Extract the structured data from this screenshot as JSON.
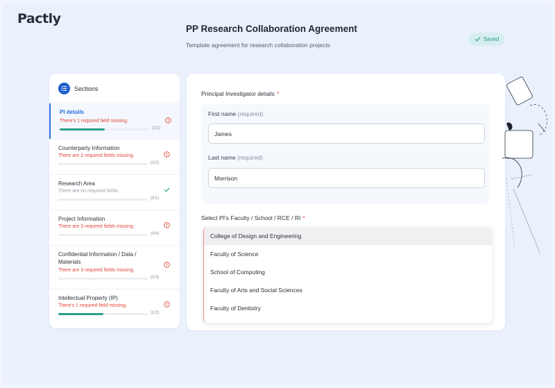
{
  "brand": {
    "logo": "Pactly"
  },
  "header": {
    "title": "PP Research Collaboration Agreement",
    "subtitle": "Template agreement for research collaboration projects",
    "saved_label": "Saved"
  },
  "sidebar": {
    "title": "Sections",
    "items": [
      {
        "label": "PI details",
        "status_text": "There's 1 required field missing.",
        "count": "(1/2)",
        "progress": 0.5,
        "state": "error",
        "active": true
      },
      {
        "label": "Counterparty Information",
        "status_text": "There are 2 required fields missing.",
        "count": "(0/2)",
        "progress": 0,
        "state": "error",
        "active": false
      },
      {
        "label": "Research Area",
        "status_text": "There are no required fields.",
        "count": "(0/1)",
        "progress": 0,
        "state": "ok",
        "active": false
      },
      {
        "label": "Project Information",
        "status_text": "There are 3 required fields missing.",
        "count": "(0/4)",
        "progress": 0,
        "state": "error",
        "active": false
      },
      {
        "label": "Confidential Information / Data / Materials",
        "status_text": "There are 3 required fields missing.",
        "count": "(0/3)",
        "progress": 0,
        "state": "error",
        "active": false
      },
      {
        "label": "Intellectual Property (IP)",
        "status_text": "There's 1 required field missing.",
        "count": "(1/2)",
        "progress": 0.5,
        "state": "error",
        "active": false
      }
    ]
  },
  "form": {
    "pi_section_title": "Principal Investigator details",
    "required_star": "*",
    "first_name": {
      "label": "First name",
      "hint": "(required)",
      "value": "James"
    },
    "last_name": {
      "label": "Last name",
      "hint": "(required)",
      "value": "Morrison"
    },
    "faculty_title": "Select PI's Faculty / School / RCE / RI",
    "faculty_options": [
      "College of Design and Engineering",
      "Faculty of Science",
      "School of Computing",
      "Faculty of Arts and Social Sciences",
      "Faculty of Dentistry"
    ],
    "faculty_highlighted": "College of Design and Engineering"
  },
  "colors": {
    "accent": "#2c6fdc",
    "error": "#e2463b",
    "success": "#2aa08c"
  },
  "icons": {
    "saved": "check-icon",
    "sections": "list-icon",
    "error": "error-circle-icon",
    "ok": "check-icon"
  }
}
